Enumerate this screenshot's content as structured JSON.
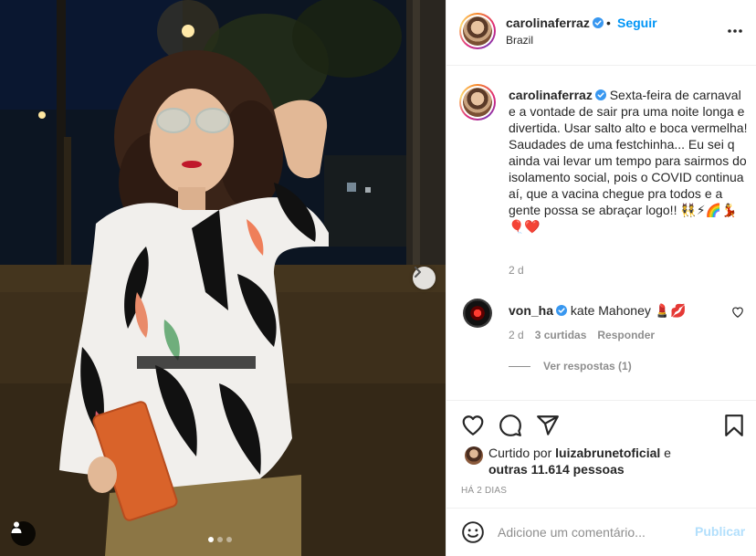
{
  "post": {
    "author": "carolinaferraz",
    "location": "Brazil",
    "follow_label": "Seguir",
    "separator": "•",
    "caption": "Sexta-feira de carnaval e a vontade de sair pra uma noite longa e divertida. Usar salto alto e boca vermelha! Saudades de uma festchinha... Eu sei q ainda vai levar um tempo para sairmos do isolamento social, pois o COVID continua aí, que a vacina chegue pra todos e a gente possa se abraçar logo!! 👯⚡🌈💃🎈❤️",
    "caption_time": "2 d",
    "carousel": {
      "slides": 3,
      "current": 1
    }
  },
  "comments": [
    {
      "user": "von_ha",
      "text": "kate Mahoney 💄💋",
      "time": "2 d",
      "likes": "3 curtidas",
      "reply_label": "Responder",
      "view_replies": "Ver respostas (1)"
    }
  ],
  "likes": {
    "prefix": "Curtido por",
    "user": "luizabrunetoficial",
    "joiner": "e",
    "others": "outras 11.614 pessoas"
  },
  "date_label": "HÁ 2 DIAS",
  "composer": {
    "placeholder": "Adicione um comentário...",
    "publish_label": "Publicar"
  },
  "icons": {
    "header_more": "more-dots-icon",
    "verified": "verified-badge-icon",
    "like": "heart-icon",
    "comment": "comment-bubble-icon",
    "share": "paper-plane-icon",
    "save": "bookmark-icon",
    "emoji": "smiley-icon",
    "next": "chevron-right-icon",
    "tags": "user-tag-icon"
  },
  "colors": {
    "link_blue": "#0095f6",
    "muted": "#8e8e8e",
    "publish_disabled": "#b2dffc",
    "verified": "#3897f0"
  }
}
